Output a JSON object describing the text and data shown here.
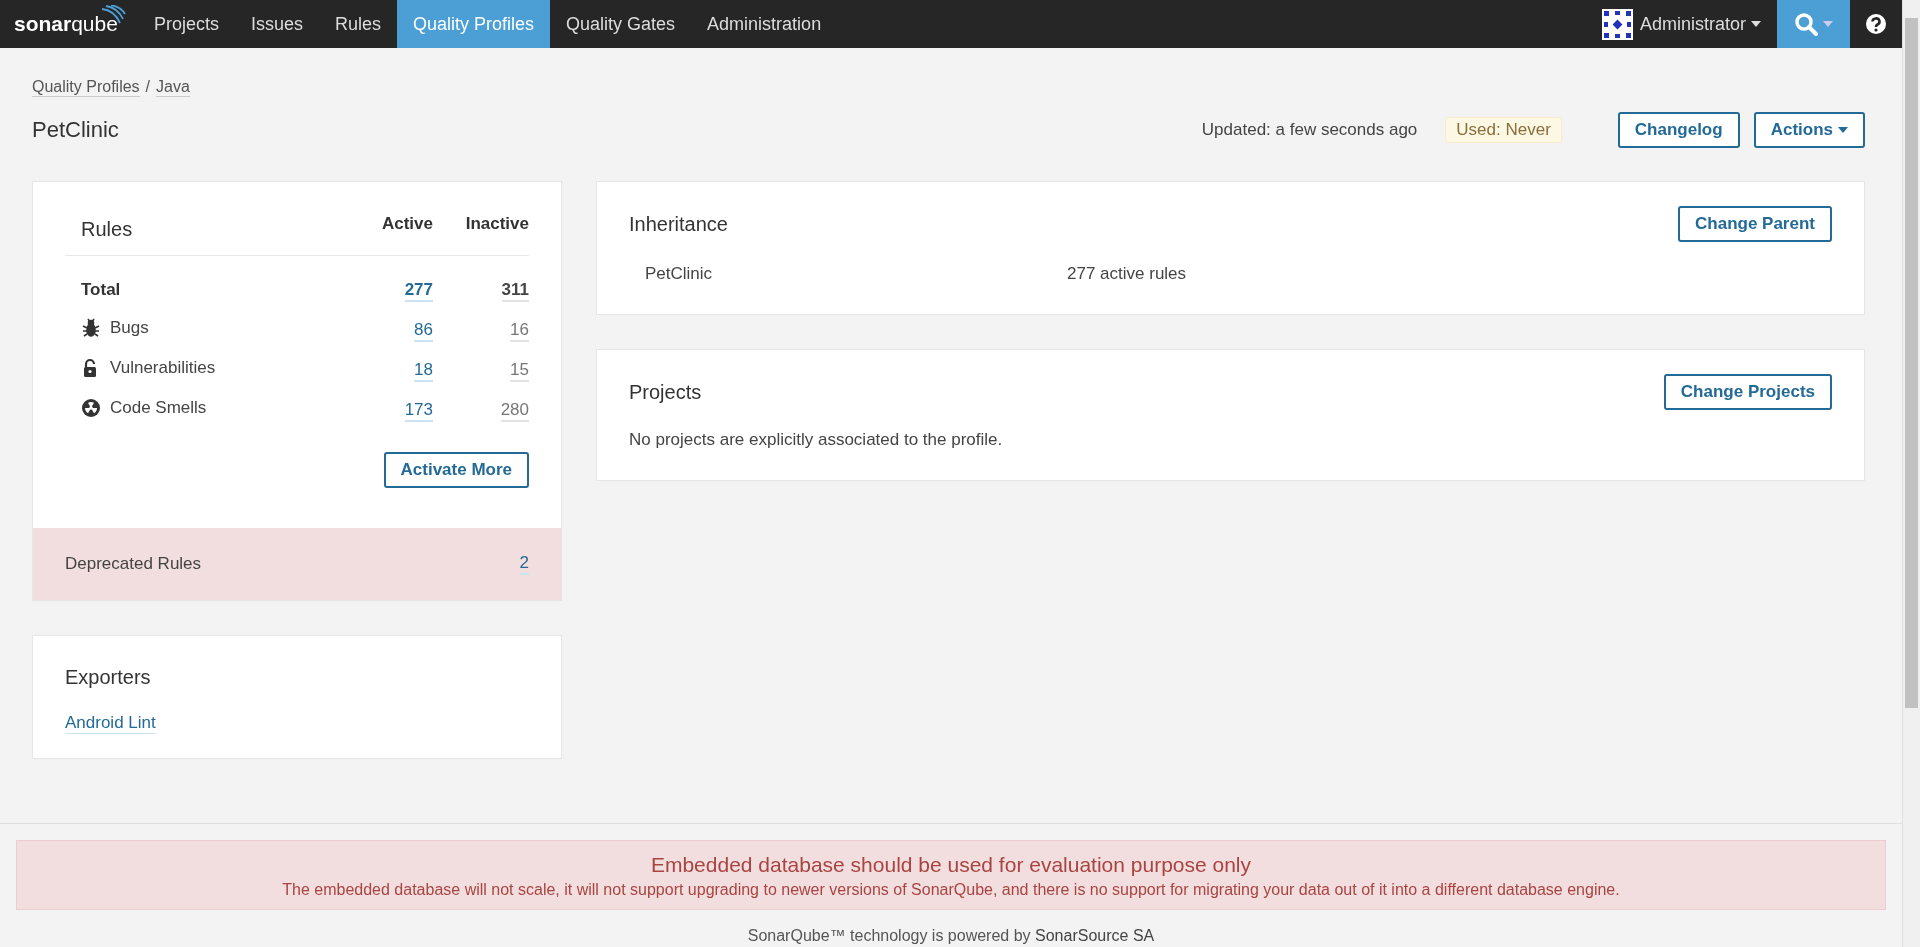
{
  "navbar": {
    "logo": "**sonar**qube",
    "items": [
      {
        "label": "Projects",
        "selected": false
      },
      {
        "label": "Issues",
        "selected": false
      },
      {
        "label": "Rules",
        "selected": false
      },
      {
        "label": "Quality Profiles",
        "selected": true
      },
      {
        "label": "Quality Gates",
        "selected": false
      },
      {
        "label": "Administration",
        "selected": false
      }
    ],
    "user": "Administrator"
  },
  "breadcrumb": {
    "items": [
      "Quality Profiles",
      "Java"
    ],
    "separator": "/"
  },
  "header": {
    "title": "PetClinic",
    "updated": "Updated: a few seconds ago",
    "used": "Used: Never",
    "buttons": [
      {
        "label": "Changelog",
        "kind": "plain"
      },
      {
        "label": "Actions",
        "kind": "dropdown"
      }
    ]
  },
  "rules": {
    "title": "Rules",
    "active_heading": "Active",
    "inactive_heading": "Inactive",
    "rows": [
      {
        "kind": "total",
        "label": "Total",
        "active": "277",
        "inactive": "311"
      },
      {
        "kind": "bug",
        "label": "Bugs",
        "active": "86",
        "inactive": "16"
      },
      {
        "kind": "vulnerability",
        "label": "Vulnerabilities",
        "active": "18",
        "inactive": "15"
      },
      {
        "kind": "code_smell",
        "label": "Code Smells",
        "active": "173",
        "inactive": "280"
      }
    ],
    "button": "Activate More",
    "deprecated": {
      "label": "Deprecated Rules",
      "count": "2"
    }
  },
  "exporters": {
    "title": "Exporters",
    "links": [
      "Android Lint"
    ]
  },
  "inheritance": {
    "title": "Inheritance",
    "button": "Change Parent",
    "rows": [
      {
        "name": "PetClinic",
        "info": "277 active rules"
      }
    ]
  },
  "projects": {
    "title": "Projects",
    "button": "Change Projects",
    "message": "No projects are explicitly associated to the profile."
  },
  "alert": {
    "title": "Embedded database should be used for evaluation purpose only",
    "message": "The embedded database will not scale, it will not support upgrading to newer versions of SonarQube, and there is no support for migrating your data out of it into a different database engine."
  },
  "footer": {
    "text": "SonarQube™ technology is powered by",
    "link": "SonarSource SA"
  }
}
